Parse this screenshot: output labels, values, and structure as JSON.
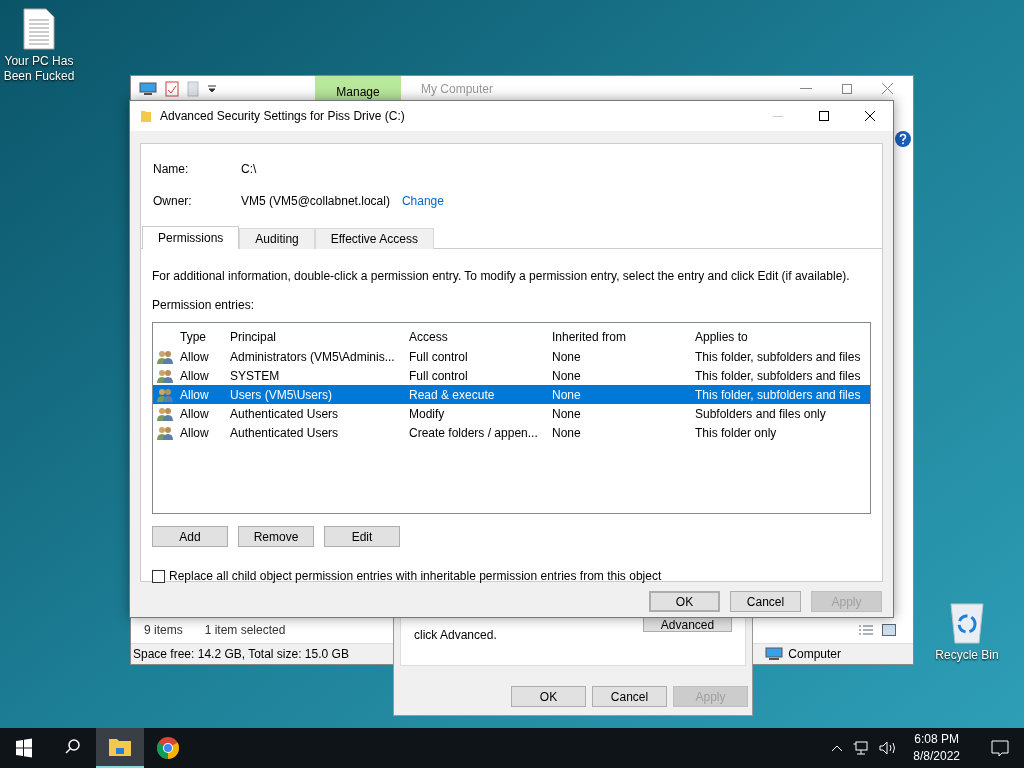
{
  "desktop_icons": [
    {
      "label": "Your PC Has Been Fucked",
      "kind": "document"
    },
    {
      "label": "Recycle Bin",
      "kind": "recycle"
    }
  ],
  "explorer": {
    "ribbon_tab": "Manage",
    "title": "My Computer",
    "item_count": "9 items",
    "selection": "1 item selected",
    "space": "Space free: 14.2 GB, Total size: 15.0 GB",
    "location": "Computer"
  },
  "properties_dialog": {
    "text": "click Advanced.",
    "advanced_button": "Advanced",
    "buttons": [
      {
        "label": "OK",
        "disabled": false
      },
      {
        "label": "Cancel",
        "disabled": false
      },
      {
        "label": "Apply",
        "disabled": true
      }
    ]
  },
  "dialog": {
    "title": "Advanced Security Settings for Piss Drive (C:)",
    "name_label": "Name:",
    "name_value": "C:\\",
    "owner_label": "Owner:",
    "owner_value": "VM5 (VM5@collabnet.local)",
    "owner_link": "Change",
    "tabs": [
      {
        "label": "Permissions",
        "selected": true
      },
      {
        "label": "Auditing",
        "selected": false
      },
      {
        "label": "Effective Access",
        "selected": false
      }
    ],
    "instructions": "For additional information, double-click a permission entry. To modify a permission entry, select the entry and click Edit (if available).",
    "entries_label": "Permission entries:",
    "columns": [
      "Type",
      "Principal",
      "Access",
      "Inherited from",
      "Applies to"
    ],
    "rows": [
      {
        "cells": [
          "Allow",
          "Administrators (VM5\\Adminis...",
          "Full control",
          "None",
          "This folder, subfolders and files"
        ],
        "selected": false
      },
      {
        "cells": [
          "Allow",
          "SYSTEM",
          "Full control",
          "None",
          "This folder, subfolders and files"
        ],
        "selected": false
      },
      {
        "cells": [
          "Allow",
          "Users (VM5\\Users)",
          "Read & execute",
          "None",
          "This folder, subfolders and files"
        ],
        "selected": true
      },
      {
        "cells": [
          "Allow",
          "Authenticated Users",
          "Modify",
          "None",
          "Subfolders and files only"
        ],
        "selected": false
      },
      {
        "cells": [
          "Allow",
          "Authenticated Users",
          "Create folders / appen...",
          "None",
          "This folder only"
        ],
        "selected": false
      }
    ],
    "entry_buttons": [
      {
        "label": "Add",
        "disabled": false
      },
      {
        "label": "Remove",
        "disabled": false
      },
      {
        "label": "Edit",
        "disabled": false
      }
    ],
    "replace_checkbox": {
      "label": "Replace all child object permission entries with inheritable permission entries from this object",
      "checked": false
    },
    "buttons": [
      {
        "label": "OK",
        "disabled": false,
        "default": true
      },
      {
        "label": "Cancel",
        "disabled": false,
        "default": false
      },
      {
        "label": "Apply",
        "disabled": true,
        "default": false
      }
    ]
  },
  "taskbar": {
    "apps": [
      {
        "kind": "explorer",
        "selected": true
      },
      {
        "kind": "chrome",
        "selected": false
      }
    ],
    "time": "6:08 PM",
    "date": "8/8/2022"
  }
}
